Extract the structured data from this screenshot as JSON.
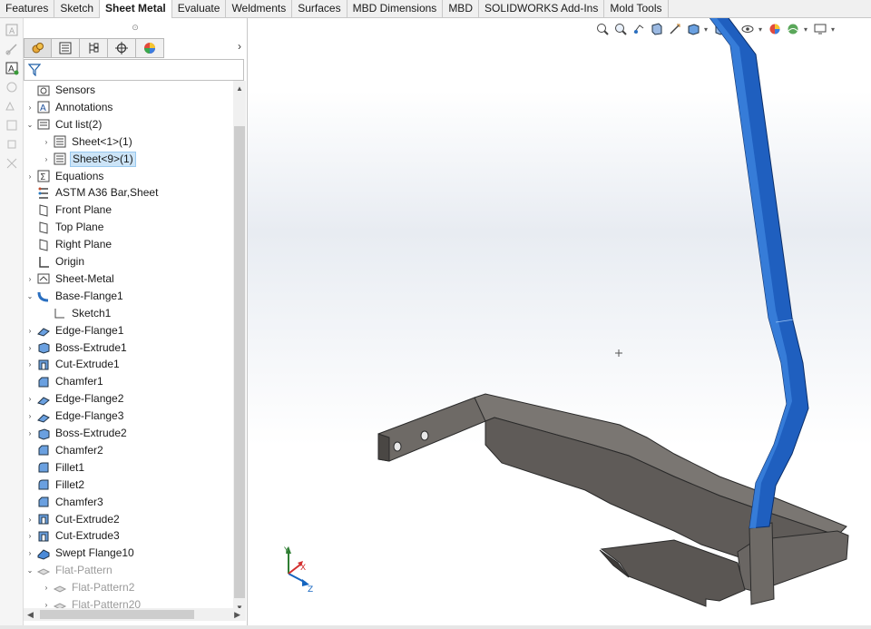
{
  "tabs": [
    {
      "label": "Features",
      "active": false
    },
    {
      "label": "Sketch",
      "active": false
    },
    {
      "label": "Sheet Metal",
      "active": true
    },
    {
      "label": "Evaluate",
      "active": false
    },
    {
      "label": "Weldments",
      "active": false
    },
    {
      "label": "Surfaces",
      "active": false
    },
    {
      "label": "MBD Dimensions",
      "active": false
    },
    {
      "label": "MBD",
      "active": false
    },
    {
      "label": "SOLIDWORKS Add-Ins",
      "active": false
    },
    {
      "label": "Mold Tools",
      "active": false
    }
  ],
  "feature_manager": {
    "panel_tabs": [
      "feature-manager-tab",
      "property-manager-tab",
      "configuration-manager-tab",
      "dimxpert-manager-tab",
      "display-manager-tab"
    ],
    "more_arrow": "›",
    "tree": [
      {
        "label": "Sensors",
        "icon": "sensors-icon",
        "expand": "",
        "indent": 0
      },
      {
        "label": "Annotations",
        "icon": "annotations-icon",
        "expand": "›",
        "indent": 0
      },
      {
        "label": "Cut list(2)",
        "icon": "cut-list-icon",
        "expand": "⌄",
        "indent": 0
      },
      {
        "label": "Sheet<1>(1)",
        "icon": "sheet-body-icon",
        "expand": "›",
        "indent": 1
      },
      {
        "label": "Sheet<9>(1)",
        "icon": "sheet-body-icon",
        "expand": "›",
        "indent": 1,
        "selected": true
      },
      {
        "label": "Equations",
        "icon": "equations-icon",
        "expand": "›",
        "indent": 0
      },
      {
        "label": "ASTM A36 Bar,Sheet",
        "icon": "material-icon",
        "expand": "",
        "indent": 0
      },
      {
        "label": "Front Plane",
        "icon": "plane-icon",
        "expand": "",
        "indent": 0
      },
      {
        "label": "Top Plane",
        "icon": "plane-icon",
        "expand": "",
        "indent": 0
      },
      {
        "label": "Right Plane",
        "icon": "plane-icon",
        "expand": "",
        "indent": 0
      },
      {
        "label": "Origin",
        "icon": "origin-icon",
        "expand": "",
        "indent": 0
      },
      {
        "label": "Sheet-Metal",
        "icon": "sheet-metal-icon",
        "expand": "›",
        "indent": 0
      },
      {
        "label": "Base-Flange1",
        "icon": "base-flange-icon",
        "expand": "⌄",
        "indent": 0
      },
      {
        "label": "Sketch1",
        "icon": "sketch-icon",
        "expand": "",
        "indent": 1
      },
      {
        "label": "Edge-Flange1",
        "icon": "edge-flange-icon",
        "expand": "›",
        "indent": 0
      },
      {
        "label": "Boss-Extrude1",
        "icon": "boss-extrude-icon",
        "expand": "›",
        "indent": 0
      },
      {
        "label": "Cut-Extrude1",
        "icon": "cut-extrude-icon",
        "expand": "›",
        "indent": 0
      },
      {
        "label": "Chamfer1",
        "icon": "chamfer-icon",
        "expand": "",
        "indent": 0
      },
      {
        "label": "Edge-Flange2",
        "icon": "edge-flange-icon",
        "expand": "›",
        "indent": 0
      },
      {
        "label": "Edge-Flange3",
        "icon": "edge-flange-icon",
        "expand": "›",
        "indent": 0
      },
      {
        "label": "Boss-Extrude2",
        "icon": "boss-extrude-icon",
        "expand": "›",
        "indent": 0
      },
      {
        "label": "Chamfer2",
        "icon": "chamfer-icon",
        "expand": "",
        "indent": 0
      },
      {
        "label": "Fillet1",
        "icon": "fillet-icon",
        "expand": "",
        "indent": 0
      },
      {
        "label": "Fillet2",
        "icon": "fillet-icon",
        "expand": "",
        "indent": 0
      },
      {
        "label": "Chamfer3",
        "icon": "chamfer-icon",
        "expand": "",
        "indent": 0
      },
      {
        "label": "Cut-Extrude2",
        "icon": "cut-extrude-icon",
        "expand": "›",
        "indent": 0
      },
      {
        "label": "Cut-Extrude3",
        "icon": "cut-extrude-icon",
        "expand": "›",
        "indent": 0
      },
      {
        "label": "Swept Flange10",
        "icon": "swept-flange-icon",
        "expand": "›",
        "indent": 0
      },
      {
        "label": "Flat-Pattern",
        "icon": "flat-pattern-icon",
        "expand": "⌄",
        "indent": 0,
        "dim": true
      },
      {
        "label": "Flat-Pattern2",
        "icon": "flat-pattern-icon",
        "expand": "›",
        "indent": 1,
        "dim": true
      },
      {
        "label": "Flat-Pattern20",
        "icon": "flat-pattern-icon",
        "expand": "›",
        "indent": 1,
        "dim": true
      }
    ]
  },
  "viewport": {
    "hud_icons": [
      "zoom-to-fit-icon",
      "zoom-to-area-icon",
      "previous-view-icon",
      "section-view-icon",
      "dynamic-annotation-icon",
      "view-orientation-icon",
      "display-style-icon",
      "hide-show-items-icon",
      "edit-appearance-icon",
      "apply-scene-icon",
      "view-settings-icon"
    ],
    "triad": {
      "x_label": "X",
      "y_label": "Y",
      "z_label": "Z"
    },
    "colors": {
      "part_gray": "#6e6a66",
      "part_edge": "#2a2a2a",
      "selected_blue": "#1f5fbf",
      "triad_x": "#d32f2f",
      "triad_y": "#2e7d32",
      "triad_z": "#1565c0"
    }
  }
}
